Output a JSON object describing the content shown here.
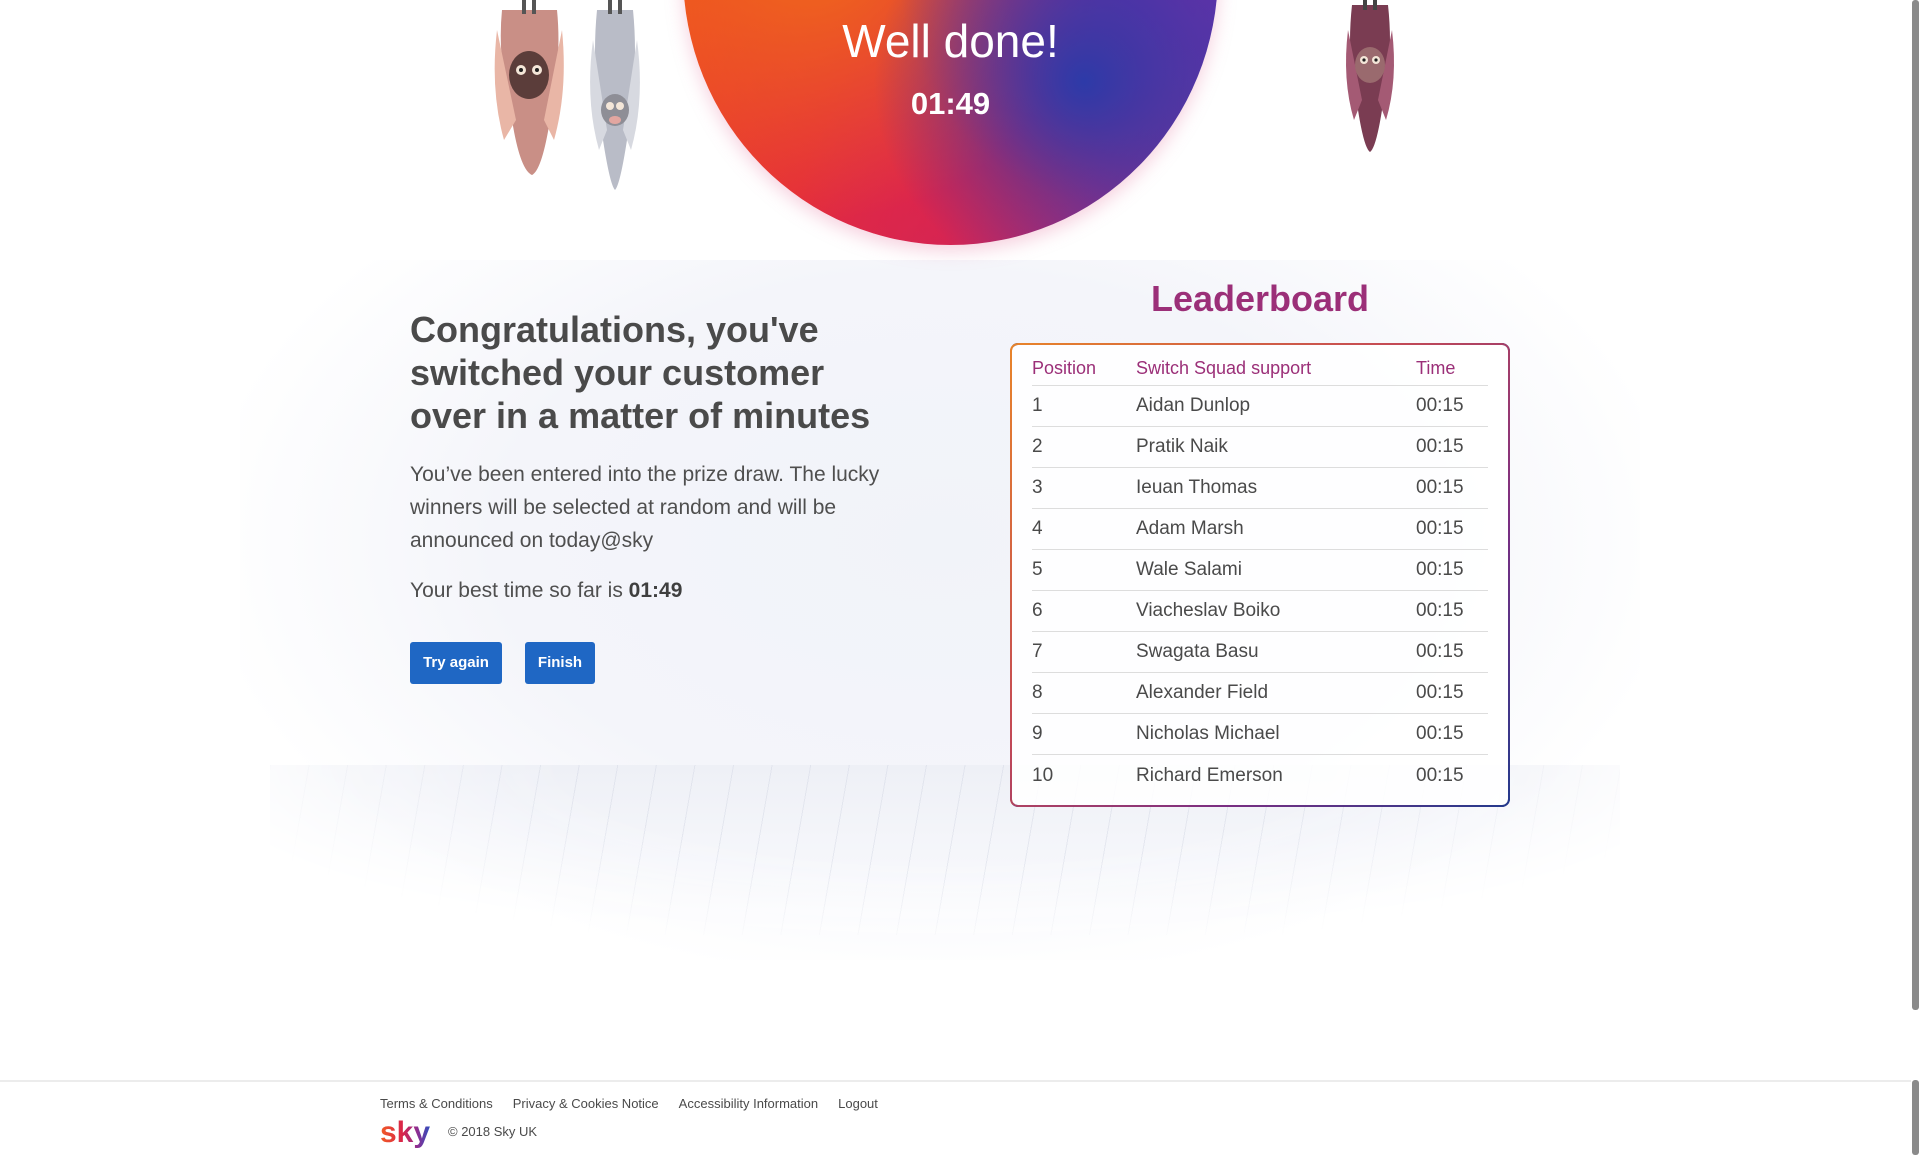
{
  "hero": {
    "title": "Well done!",
    "time": "01:49"
  },
  "main": {
    "heading": "Congratulations, you've switched your customer over in a matter of minutes",
    "body": "You’ve been entered into the prize draw. The lucky winners will be selected at random and will be announced on today@sky",
    "best_time_prefix": "Your best time so far is",
    "best_time_value": "01:49",
    "buttons": {
      "try_again": "Try again",
      "finish": "Finish"
    }
  },
  "leaderboard": {
    "title": "Leaderboard",
    "columns": [
      "Position",
      "Switch Squad support",
      "Time"
    ],
    "rows": [
      {
        "position": "1",
        "name": "Aidan Dunlop",
        "time": "00:15"
      },
      {
        "position": "2",
        "name": "Pratik Naik",
        "time": "00:15"
      },
      {
        "position": "3",
        "name": "Ieuan Thomas",
        "time": "00:15"
      },
      {
        "position": "4",
        "name": "Adam Marsh",
        "time": "00:15"
      },
      {
        "position": "5",
        "name": "Wale Salami",
        "time": "00:15"
      },
      {
        "position": "6",
        "name": "Viacheslav Boiko",
        "time": "00:15"
      },
      {
        "position": "7",
        "name": "Swagata Basu",
        "time": "00:15"
      },
      {
        "position": "8",
        "name": "Alexander Field",
        "time": "00:15"
      },
      {
        "position": "9",
        "name": "Nicholas Michael",
        "time": "00:15"
      },
      {
        "position": "10",
        "name": "Richard Emerson",
        "time": "00:15"
      }
    ]
  },
  "footer": {
    "links": [
      "Terms & Conditions",
      "Privacy & Cookies Notice",
      "Accessibility Information",
      "Logout"
    ],
    "logo_text": "sky",
    "copyright": "© 2018 Sky UK"
  },
  "colors": {
    "accent_purple": "#9b2f78",
    "button_blue": "#1f67c4"
  }
}
